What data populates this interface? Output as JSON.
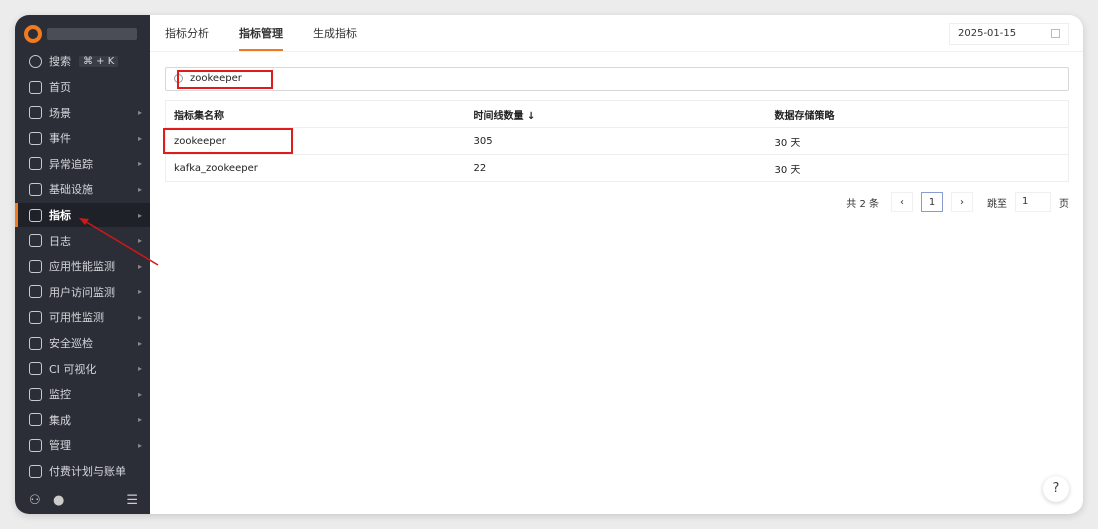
{
  "sidebar": {
    "search_label": "搜索",
    "shortcut": "⌘ + K",
    "items": [
      {
        "label": "首页",
        "arrow": false
      },
      {
        "label": "场景",
        "arrow": true
      },
      {
        "label": "事件",
        "arrow": true
      },
      {
        "label": "异常追踪",
        "arrow": true
      },
      {
        "label": "基础设施",
        "arrow": true
      },
      {
        "label": "指标",
        "arrow": true,
        "active": true
      },
      {
        "label": "日志",
        "arrow": true
      },
      {
        "label": "应用性能监测",
        "arrow": true
      },
      {
        "label": "用户访问监测",
        "arrow": true
      },
      {
        "label": "可用性监测",
        "arrow": true
      },
      {
        "label": "安全巡检",
        "arrow": true
      },
      {
        "label": "CI 可视化",
        "arrow": true
      },
      {
        "label": "监控",
        "arrow": true
      },
      {
        "label": "集成",
        "arrow": true
      },
      {
        "label": "管理",
        "arrow": true
      },
      {
        "label": "付费计划与账单",
        "arrow": false
      }
    ]
  },
  "tabs": [
    "指标分析",
    "指标管理",
    "生成指标"
  ],
  "date": "2025-01-15",
  "search": {
    "value": "zookeeper"
  },
  "table": {
    "headers": [
      "指标集名称",
      "时间线数量 ↓",
      "数据存储策略"
    ],
    "rows": [
      [
        "zookeeper",
        "305",
        "30 天"
      ],
      [
        "kafka_zookeeper",
        "22",
        "30 天"
      ]
    ]
  },
  "pager": {
    "total": "共 2 条",
    "prev": "‹",
    "page": "1",
    "next": "›",
    "jump_label": "跳至",
    "jump_value": "1",
    "page_suffix": "页"
  },
  "help": "?",
  "colors": {
    "accent": "#f07a1f",
    "highlight": "#e01b1b",
    "sidebar": "#2b2e36"
  }
}
